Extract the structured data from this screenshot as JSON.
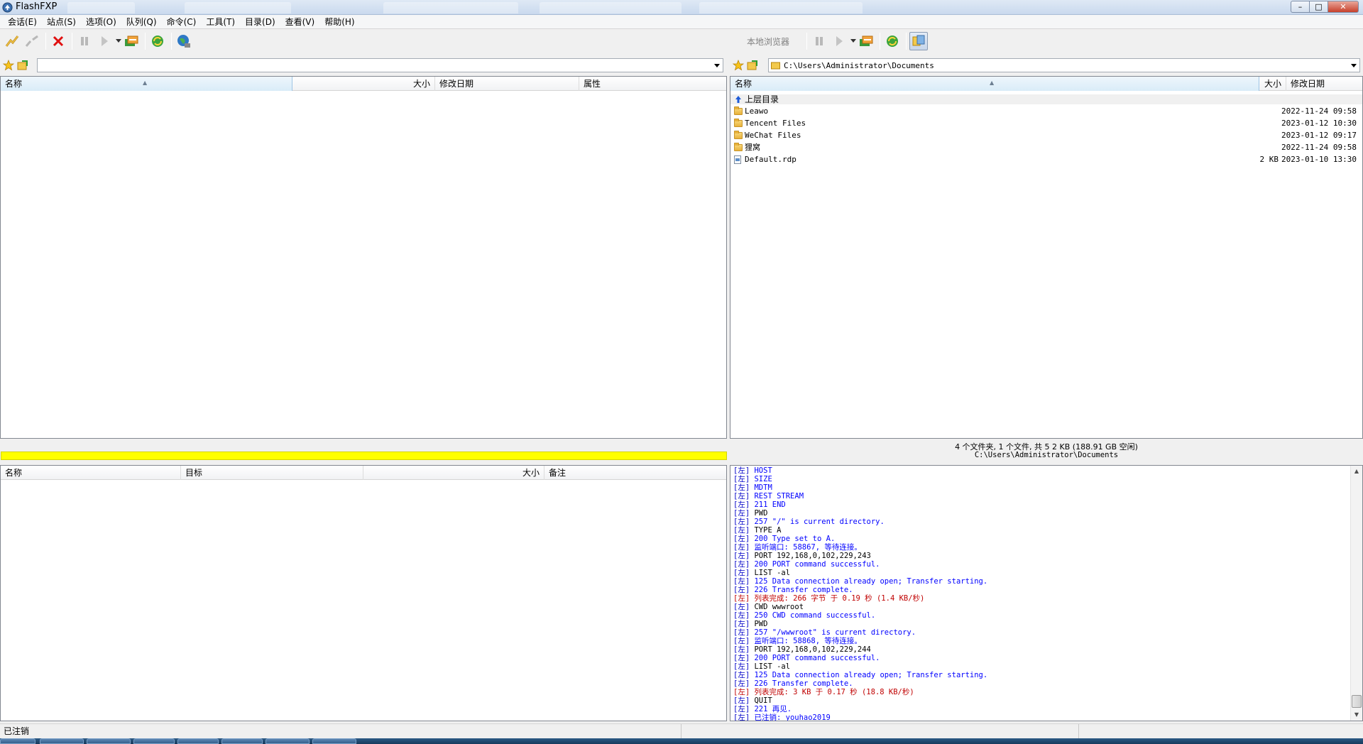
{
  "window": {
    "title": "FlashFXP",
    "controls": [
      "minimize-icon",
      "maximize-icon",
      "close-icon"
    ]
  },
  "menu": [
    "会话(E)",
    "站点(S)",
    "选项(O)",
    "队列(Q)",
    "命令(C)",
    "工具(T)",
    "目录(D)",
    "查看(V)",
    "帮助(H)"
  ],
  "remote": {
    "toolbar_icons": [
      "connect-icon",
      "disconnect-icon",
      "abort-icon",
      "pause-icon",
      "play-icon",
      "dropdown-icon",
      "transfer-icon",
      "refresh-icon",
      "globe-icon"
    ],
    "path": "",
    "columns": [
      "名称",
      "大小",
      "修改日期",
      "属性"
    ],
    "rows": []
  },
  "local": {
    "browser_label": "本地浏览器",
    "path": "C:\\Users\\Administrator\\Documents",
    "columns": [
      "名称",
      "大小",
      "修改日期"
    ],
    "up_label": "上层目录",
    "rows": [
      {
        "name": "Leawo",
        "size": "",
        "date": "2022-11-24 09:58",
        "type": "folder"
      },
      {
        "name": "Tencent Files",
        "size": "",
        "date": "2023-01-12 10:30",
        "type": "folder"
      },
      {
        "name": "WeChat Files",
        "size": "",
        "date": "2023-01-12 09:17",
        "type": "folder"
      },
      {
        "name": "狸窝",
        "size": "",
        "date": "2022-11-24 09:58",
        "type": "folder"
      },
      {
        "name": "Default.rdp",
        "size": "2 KB",
        "date": "2023-01-10 13:30",
        "type": "file"
      }
    ],
    "status_summary": "4 个文件夹, 1 个文件, 共 5 2 KB (188.91 GB 空闲)",
    "status_path": "C:\\Users\\Administrator\\Documents"
  },
  "queue": {
    "columns": [
      "名称",
      "目标",
      "大小",
      "备注"
    ],
    "progress": 1.0,
    "progress_color": "#ffff00"
  },
  "log": {
    "prefix": "[左]",
    "lines": [
      {
        "text": " HOST",
        "color": "blue"
      },
      {
        "text": " SIZE",
        "color": "blue"
      },
      {
        "text": " MDTM",
        "color": "blue"
      },
      {
        "text": " REST STREAM",
        "color": "blue"
      },
      {
        "text": "211 END",
        "color": "blue"
      },
      {
        "text": "PWD",
        "color": "black"
      },
      {
        "text": "257 \"/\" is current directory.",
        "color": "blue"
      },
      {
        "text": "TYPE A",
        "color": "black"
      },
      {
        "text": "200 Type set to A.",
        "color": "blue"
      },
      {
        "text": "监听端口: 58867, 等待连接。",
        "color": "blue"
      },
      {
        "text": "PORT 192,168,0,102,229,243",
        "color": "black"
      },
      {
        "text": "200 PORT command successful.",
        "color": "blue"
      },
      {
        "text": "LIST -al",
        "color": "black"
      },
      {
        "text": "125 Data connection already open; Transfer starting.",
        "color": "blue"
      },
      {
        "text": "226 Transfer complete.",
        "color": "blue"
      },
      {
        "text": "列表完成: 266 字节 于 0.19 秒 (1.4 KB/秒)",
        "color": "red"
      },
      {
        "text": "CWD wwwroot",
        "color": "black"
      },
      {
        "text": "250 CWD command successful.",
        "color": "blue"
      },
      {
        "text": "PWD",
        "color": "black"
      },
      {
        "text": "257 \"/wwwroot\" is current directory.",
        "color": "blue"
      },
      {
        "text": "监听端口: 58868, 等待连接。",
        "color": "blue"
      },
      {
        "text": "PORT 192,168,0,102,229,244",
        "color": "black"
      },
      {
        "text": "200 PORT command successful.",
        "color": "blue"
      },
      {
        "text": "LIST -al",
        "color": "black"
      },
      {
        "text": "125 Data connection already open; Transfer starting.",
        "color": "blue"
      },
      {
        "text": "226 Transfer complete.",
        "color": "blue"
      },
      {
        "text": "列表完成: 3 KB 于 0.17 秒 (18.8 KB/秒)",
        "color": "red"
      },
      {
        "text": "QUIT",
        "color": "black"
      },
      {
        "text": "221 再见.",
        "color": "blue"
      },
      {
        "text": "已注销: youhao2019",
        "color": "blue"
      }
    ]
  },
  "statusbar": {
    "text": "已注销"
  }
}
